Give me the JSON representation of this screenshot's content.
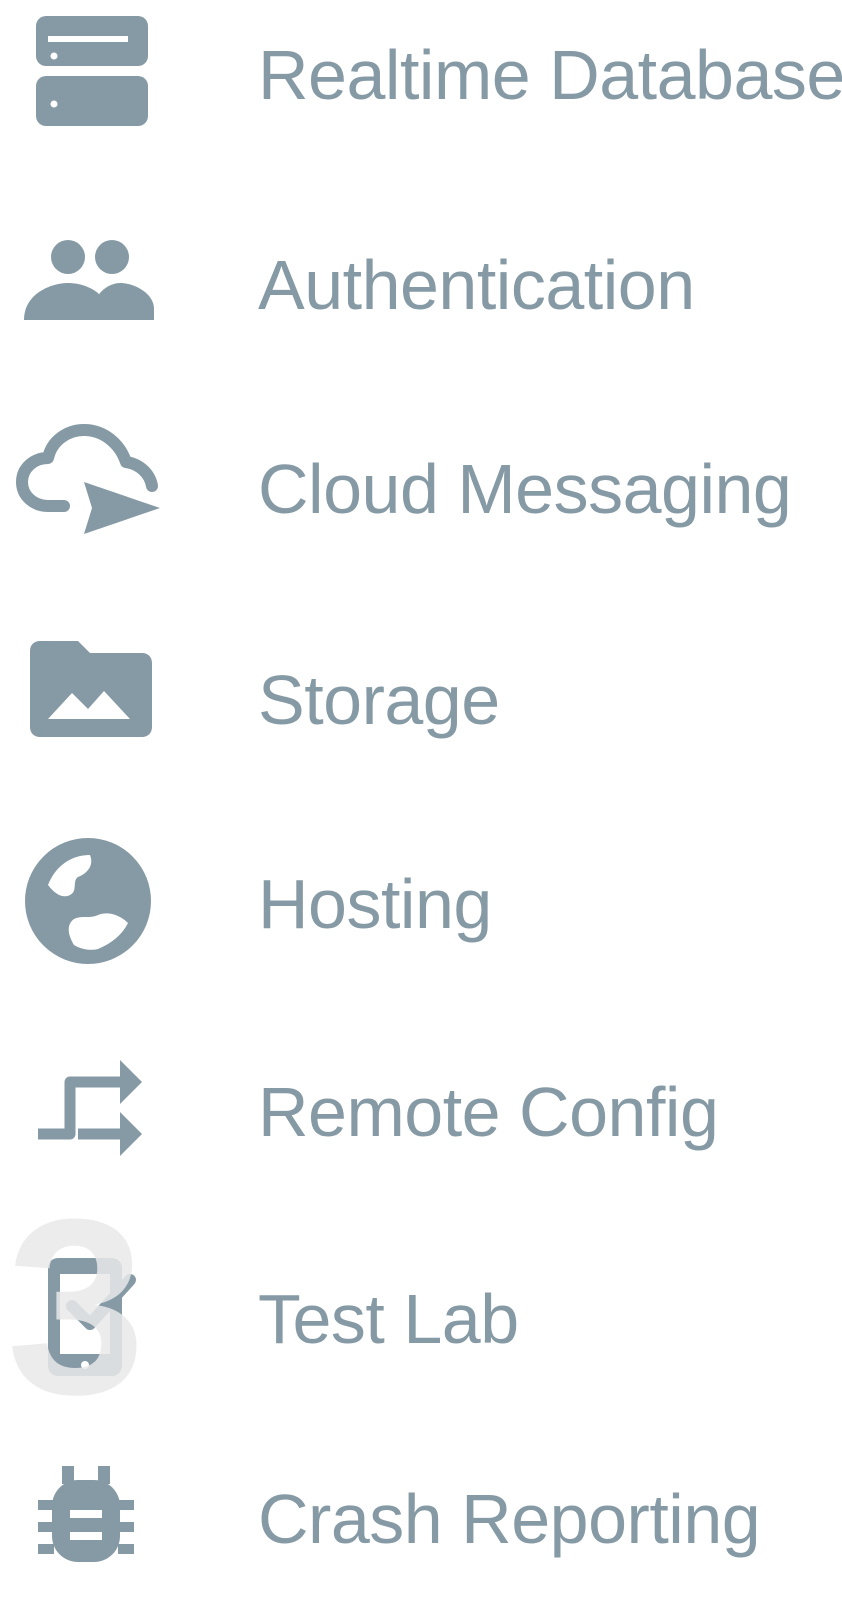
{
  "sidebar": {
    "icon_color": "#869aa5",
    "items": [
      {
        "label": "Realtime Database",
        "icon": "database-icon"
      },
      {
        "label": "Authentication",
        "icon": "people-icon"
      },
      {
        "label": "Cloud Messaging",
        "icon": "cloud-send-icon"
      },
      {
        "label": "Storage",
        "icon": "folder-image-icon"
      },
      {
        "label": "Hosting",
        "icon": "globe-icon"
      },
      {
        "label": "Remote Config",
        "icon": "swap-arrows-icon"
      },
      {
        "label": "Test Lab",
        "icon": "phone-check-icon"
      },
      {
        "label": "Crash Reporting",
        "icon": "bug-icon"
      }
    ]
  },
  "watermark": {
    "text": "3",
    "color": "#e9e9e9"
  }
}
